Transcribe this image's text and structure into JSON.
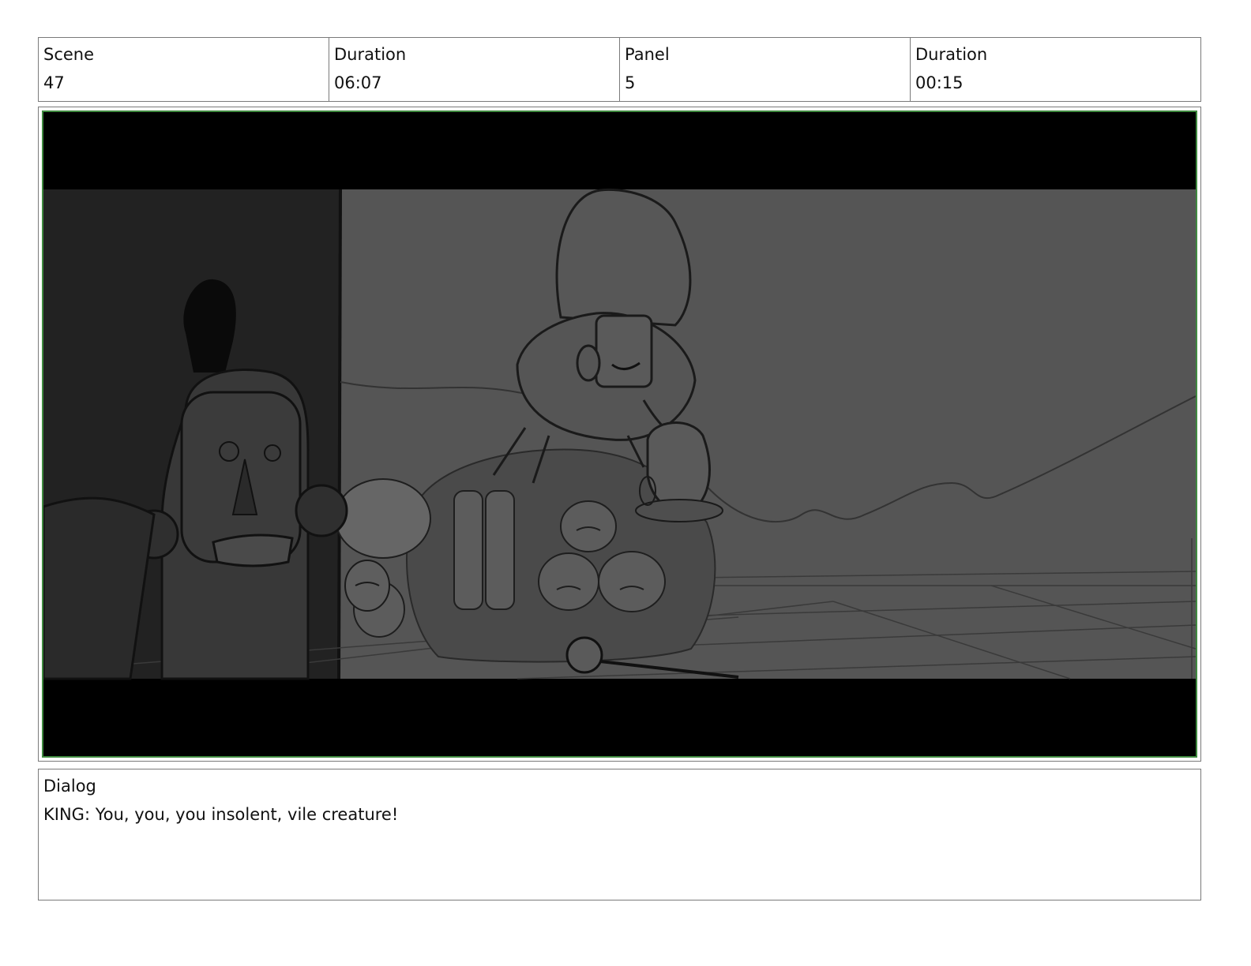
{
  "header": {
    "scene_label": "Scene",
    "scene_value": "47",
    "scene_duration_label": "Duration",
    "scene_duration_value": "06:07",
    "panel_label": "Panel",
    "panel_value": "5",
    "panel_duration_label": "Duration",
    "panel_duration_value": "00:15"
  },
  "panel": {
    "frame_border_color": "#3f8a3f",
    "letterbox_color": "#000000",
    "background_color": "#555555"
  },
  "dialog": {
    "label": "Dialog",
    "text": "KING: You, you, you insolent, vile creature!"
  }
}
